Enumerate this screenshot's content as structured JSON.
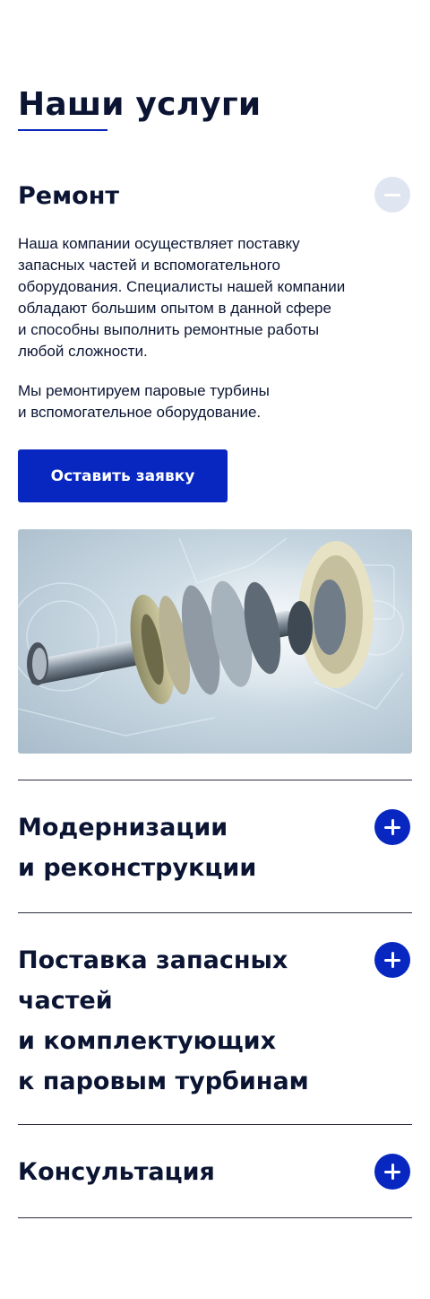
{
  "section": {
    "title": "Наши услуги"
  },
  "accordion": {
    "open_item": {
      "title": "Ремонт",
      "toggle_icon": "minus-icon",
      "paragraphs": [
        "Наша компании осуществляет поставку\nзапасных частей и вспомогательного\nоборудования. Специалисты нашей компании\nобладают большим опытом в данной сфере\nи способны выполнить ремонтные работы\nлюбой сложности.",
        "Мы ремонтируем паровые турбины\nи вспомогательное оборудование."
      ],
      "cta_label": "Оставить заявку",
      "image": "steam-turbine-rotor-image"
    },
    "items": [
      {
        "title": "Модернизации\nи реконструкции",
        "toggle_icon": "plus-icon"
      },
      {
        "title": "Поставка запасных\nчастей\nи комплектующих\nк паровым турбинам",
        "toggle_icon": "plus-icon"
      },
      {
        "title": "Консультация",
        "toggle_icon": "plus-icon"
      }
    ]
  },
  "colors": {
    "text_dark": "#0b1533",
    "accent_blue": "#0727c0",
    "toggle_open_bg": "#dfe6f1",
    "divider": "#2b2f3a"
  }
}
